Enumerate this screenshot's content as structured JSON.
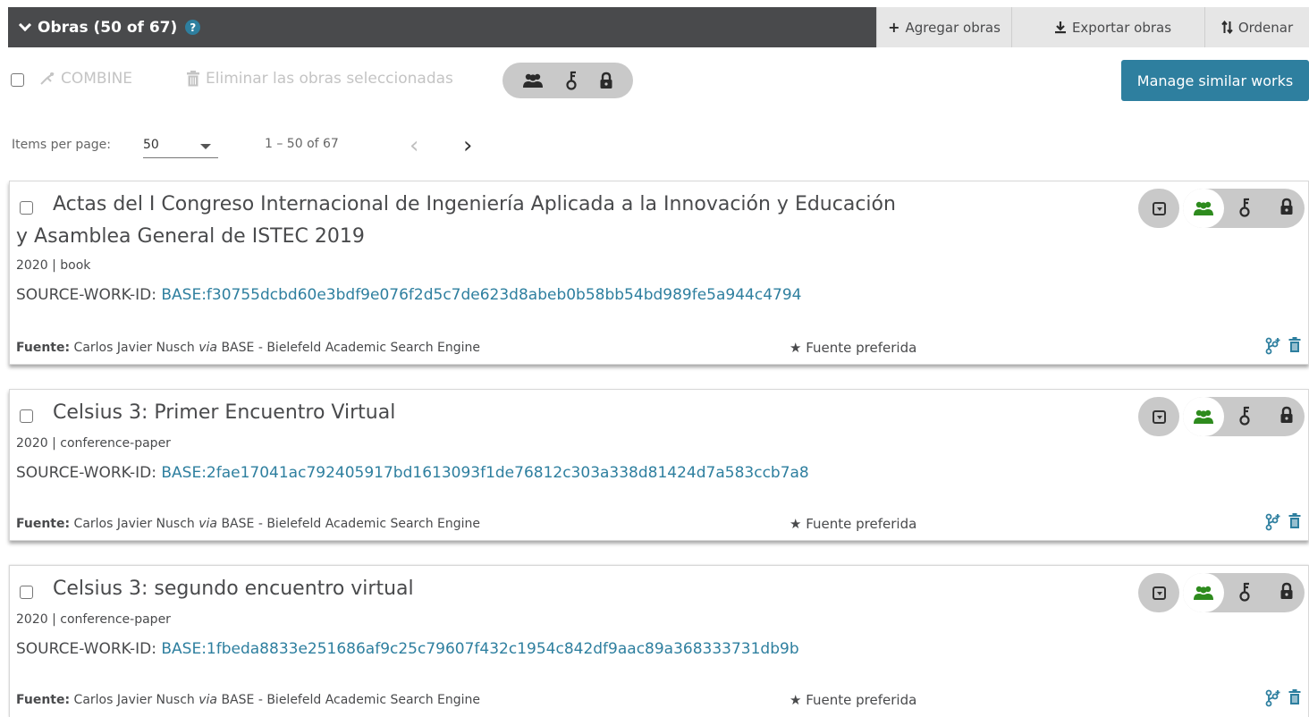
{
  "header": {
    "title": "Obras (50 of 67)",
    "help": "?",
    "add_label": "Agregar obras",
    "export_label": "Exportar obras",
    "sort_label": "Ordenar"
  },
  "bulk": {
    "combine_label": "COMBINE",
    "delete_label": "Eliminar las obras seleccionadas",
    "manage_label": "Manage similar works"
  },
  "pager": {
    "items_per_page_label": "Items per page:",
    "items_per_page_value": "50",
    "range": "1 – 50 of 67",
    "prev": "‹",
    "next": "›"
  },
  "works": [
    {
      "title": "Actas del I Congreso Internacional de Ingeniería Aplicada a la Innovación y Educación y Asamblea General de ISTEC 2019",
      "meta": "2020 | book",
      "sid_label": "SOURCE-WORK-ID:",
      "sid_value": "BASE:f30755dcbd60e3bdf9e076f2d5c7de623d8abeb0b58bb54bd989fe5a944c4794",
      "source_label": "Fuente:",
      "source_name": "Carlos Javier Nusch",
      "via": "via",
      "source_org": "BASE - Bielefeld Academic Search Engine",
      "preferred": "★ Fuente preferida"
    },
    {
      "title": "Celsius 3: Primer Encuentro Virtual",
      "meta": "2020 | conference-paper",
      "sid_label": "SOURCE-WORK-ID:",
      "sid_value": "BASE:2fae17041ac792405917bd1613093f1de76812c303a338d81424d7a583ccb7a8",
      "source_label": "Fuente:",
      "source_name": "Carlos Javier Nusch",
      "via": "via",
      "source_org": "BASE - Bielefeld Academic Search Engine",
      "preferred": "★ Fuente preferida"
    },
    {
      "title": "Celsius 3: segundo encuentro virtual",
      "meta": "2020 | conference-paper",
      "sid_label": "SOURCE-WORK-ID:",
      "sid_value": "BASE:1fbeda8833e251686af9c25c79607f432c1954c842df9aac89a368333731db9b",
      "source_label": "Fuente:",
      "source_name": "Carlos Javier Nusch",
      "via": "via",
      "source_org": "BASE - Bielefeld Academic Search Engine",
      "preferred": "★ Fuente preferida"
    }
  ],
  "colors": {
    "header_bg": "#494A4C",
    "accent": "#2E7F9F",
    "public_green": "#2E8B1E"
  }
}
